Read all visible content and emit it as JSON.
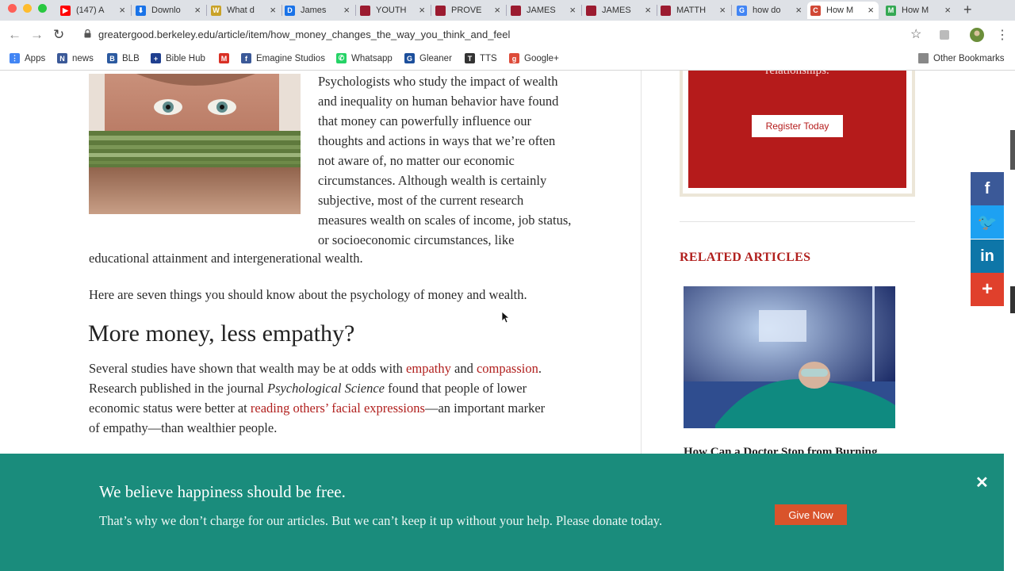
{
  "browser": {
    "tabs": [
      {
        "title": "(147) A",
        "color": "#ff0000",
        "glyph": "▶"
      },
      {
        "title": "Downlo",
        "color": "#1a73e8",
        "glyph": "⬇"
      },
      {
        "title": "What d",
        "color": "#c9a227",
        "glyph": "W"
      },
      {
        "title": "James",
        "color": "#1a73e8",
        "glyph": "D"
      },
      {
        "title": "YOUTH",
        "color": "#9b1b30",
        "glyph": ""
      },
      {
        "title": "PROVE",
        "color": "#9b1b30",
        "glyph": ""
      },
      {
        "title": "JAMES",
        "color": "#9b1b30",
        "glyph": ""
      },
      {
        "title": "JAMES",
        "color": "#9b1b30",
        "glyph": ""
      },
      {
        "title": "MATTH",
        "color": "#9b1b30",
        "glyph": ""
      },
      {
        "title": "how do",
        "color": "#4285f4",
        "glyph": "G"
      },
      {
        "title": "How M",
        "color": "#d14836",
        "glyph": "C"
      },
      {
        "title": "How M",
        "color": "#34a853",
        "glyph": "M"
      }
    ],
    "url": "greatergood.berkeley.edu/article/item/how_money_changes_the_way_you_think_and_feel",
    "bookmarks": [
      {
        "label": "Apps",
        "color": "#4285f4",
        "glyph": "⋮"
      },
      {
        "label": "news",
        "color": "#3b5998",
        "glyph": "N"
      },
      {
        "label": "BLB",
        "color": "#2c5aa0",
        "glyph": "B"
      },
      {
        "label": "Bible Hub",
        "color": "#1f3f8f",
        "glyph": "+"
      },
      {
        "label": "",
        "color": "#d93025",
        "glyph": "M"
      },
      {
        "label": "Emagine Studios",
        "color": "#3b5998",
        "glyph": "f"
      },
      {
        "label": "Whatsapp",
        "color": "#25d366",
        "glyph": "✆"
      },
      {
        "label": "Gleaner",
        "color": "#1c4f9c",
        "glyph": "G"
      },
      {
        "label": "TTS",
        "color": "#333333",
        "glyph": "T"
      },
      {
        "label": "Google+",
        "color": "#dd4b39",
        "glyph": "g"
      }
    ],
    "other_bookmarks": "Other Bookmarks"
  },
  "article": {
    "para1_lines": [
      "Psychologists who study the impact of wealth",
      "and inequality on human behavior have found",
      "that money can powerfully influence our",
      "thoughts and actions in ways that we’re often",
      "not aware of, no matter our economic",
      "circumstances. Although wealth is certainly",
      "subjective, most of the current research",
      "measures wealth on scales of income, job status,",
      "or socioeconomic circumstances, like"
    ],
    "para1_last": "educational attainment and intergenerational wealth.",
    "para2": "Here are seven things you should know about the psychology of money and wealth.",
    "heading": "More money, less empathy?",
    "para3": {
      "t1": "Several studies have shown that wealth may be at odds with ",
      "link1": "empathy",
      "t2": " and ",
      "link2": "compassion",
      "t3": ".",
      "t4": "Research published in the journal ",
      "journal": "Psychological Science",
      "t5": " found that people of lower",
      "t6": "economic status were better at ",
      "link3": "reading others’ facial expressions",
      "t7": "—an important marker",
      "t8": "of empathy—than wealthier people."
    }
  },
  "sidebar": {
    "promo_text": "relationships.",
    "register_label": "Register Today",
    "related_heading": "RELATED ARTICLES",
    "related_title": "How Can a Doctor Stop from Burning"
  },
  "share": [
    {
      "name": "facebook",
      "glyph": "f",
      "color": "#3b5998"
    },
    {
      "name": "twitter",
      "glyph": "🐦",
      "color": "#1da1f2"
    },
    {
      "name": "linkedin",
      "glyph": "in",
      "color": "#0e76a8"
    },
    {
      "name": "more",
      "glyph": "+",
      "color": "#e0402c"
    }
  ],
  "banner": {
    "title": "We believe happiness should be free.",
    "body": "That’s why we don’t charge for our articles. But we can’t keep it up without your help. Please donate today.",
    "button": "Give Now"
  },
  "colors": {
    "link_red": "#b1201e",
    "banner_green": "#1a8c7c",
    "promo_red": "#b51b1b",
    "give_orange": "#d9532b"
  }
}
